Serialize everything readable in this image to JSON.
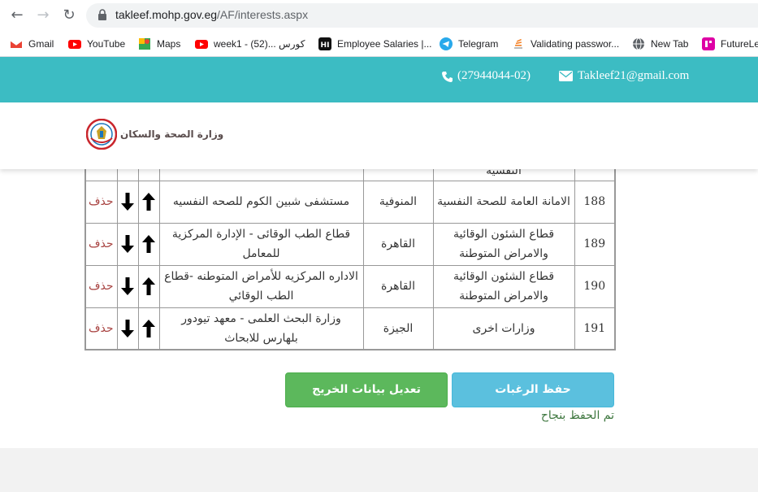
{
  "browser": {
    "url_host": "takleef.mohp.gov.eg",
    "url_path": "/AF/interests.aspx",
    "bookmarks": [
      {
        "label": "Gmail",
        "icon": "gmail-icon"
      },
      {
        "label": "YouTube",
        "icon": "youtube-icon"
      },
      {
        "label": "Maps",
        "icon": "maps-icon"
      },
      {
        "label": "week1 - كورس ...(52)",
        "icon": "youtube-icon"
      },
      {
        "label": "Employee Salaries |...",
        "icon": "hi-icon"
      },
      {
        "label": "Telegram",
        "icon": "telegram-icon"
      },
      {
        "label": "Validating passwor...",
        "icon": "stack-icon"
      },
      {
        "label": "New Tab",
        "icon": "globe-icon"
      },
      {
        "label": "FutureLe",
        "icon": "futurelearn-icon"
      }
    ]
  },
  "header": {
    "phone": "(27944044-02)",
    "email": "Takleef21@gmail.com",
    "logo_text": "وزارة الصحة والسكان"
  },
  "table": {
    "partial_row": {
      "cell": "النفسية"
    },
    "rows": [
      {
        "number": "188",
        "entity": "الامانة العامة للصحة النفسية",
        "governorate": "المنوفية",
        "place": "مستشفى شبين الكوم للصحه النفسيه",
        "delete": "حذف"
      },
      {
        "number": "189",
        "entity": "قطاع الشئون الوقائية والامراض المتوطنة",
        "governorate": "القاهرة",
        "place": "قطاع الطب الوقائى - الإدارة المركزية للمعامل",
        "delete": "حذف"
      },
      {
        "number": "190",
        "entity": "قطاع الشئون الوقائية والامراض المتوطنة",
        "governorate": "القاهرة",
        "place": "الاداره المركزيه للأمراض المتوطنه -قطاع الطب الوقائي",
        "delete": "حذف"
      },
      {
        "number": "191",
        "entity": "وزارات اخرى",
        "governorate": "الجيزة",
        "place": "وزارة البحث العلمى - معهد تيودور بلهارس للابحاث",
        "delete": "حذف"
      }
    ]
  },
  "actions": {
    "save_label": "حفظ الرغبات",
    "edit_label": "تعديل بيانات الخريج",
    "success_message": "تم الحفظ بنجاح"
  },
  "colors": {
    "header_teal": "#3cbcc3",
    "save_blue": "#5bc0de",
    "edit_green": "#5cb85c",
    "delete_red": "#a94442",
    "success_green": "#3c763d"
  }
}
